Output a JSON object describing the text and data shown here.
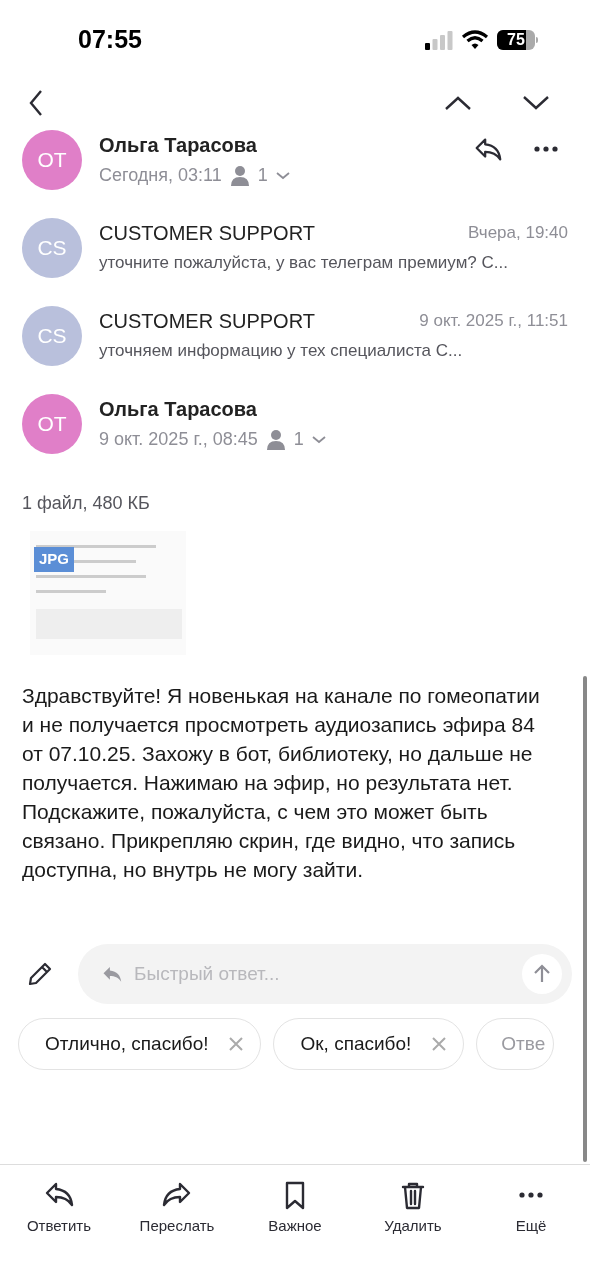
{
  "status_bar": {
    "time": "07:55",
    "battery": "75"
  },
  "thread": [
    {
      "kind": "expanded",
      "initials": "ОТ",
      "color": "#e07fc8",
      "sender": "Ольга Тарасова",
      "date": "Сегодня, 03:11",
      "recipients": "1"
    },
    {
      "kind": "collapsed",
      "initials": "CS",
      "color": "#b9c0dc",
      "sender": "CUSTOMER SUPPORT",
      "date": "Вчера, 19:40",
      "preview": "уточните пожалуйста, у вас телеграм премиум? С..."
    },
    {
      "kind": "collapsed",
      "initials": "CS",
      "color": "#b9c0dc",
      "sender": "CUSTOMER SUPPORT",
      "date": "9 окт. 2025 г., 11:51",
      "preview": "уточняем информацию у тех специалиста С..."
    },
    {
      "kind": "expanded",
      "initials": "ОТ",
      "color": "#e07fc8",
      "sender": "Ольга Тарасова",
      "date": "9 окт. 2025 г., 08:45",
      "recipients": "1"
    }
  ],
  "attachments": {
    "summary": "1 файл, 480 КБ",
    "files": [
      {
        "type": "JPG"
      }
    ]
  },
  "body": "Здравствуйте! Я новенькая на канале по гомеопатии и не получается просмотреть аудиозапись эфира 84 от 07.10.25. Захожу в бот, библиотеку, но дальше не получается. Нажимаю на эфир, но результата нет. Подскажите, пожалуйста, с чем это может быть связано. Прикрепляю скрин, где видно, что запись доступна, но внутрь не могу зайти.",
  "quick_reply": {
    "placeholder": "Быстрый ответ..."
  },
  "suggestions": [
    "Отлично, спасибо!",
    "Ок, спасибо!",
    "Отве"
  ],
  "toolbar": [
    {
      "kind": "reply",
      "label": "Ответить"
    },
    {
      "kind": "forward",
      "label": "Переслать"
    },
    {
      "kind": "bookmark",
      "label": "Важное"
    },
    {
      "kind": "delete",
      "label": "Удалить"
    },
    {
      "kind": "more",
      "label": "Ещё"
    }
  ]
}
